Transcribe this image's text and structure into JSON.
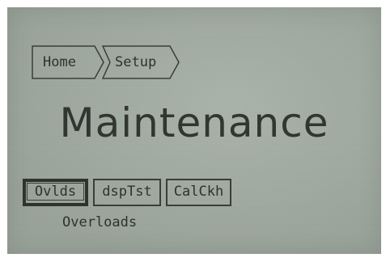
{
  "breadcrumb": {
    "items": [
      {
        "label": "Home"
      },
      {
        "label": "Setup"
      }
    ]
  },
  "screen": {
    "title": "Maintenance"
  },
  "softkeys": [
    {
      "label": "Ovlds",
      "selected": true
    },
    {
      "label": "dspTst",
      "selected": false
    },
    {
      "label": "CalCkh",
      "selected": false
    }
  ],
  "hint": "Overloads",
  "colors": {
    "lcd_background": "#a3ada3",
    "lcd_text": "#2e322e"
  }
}
